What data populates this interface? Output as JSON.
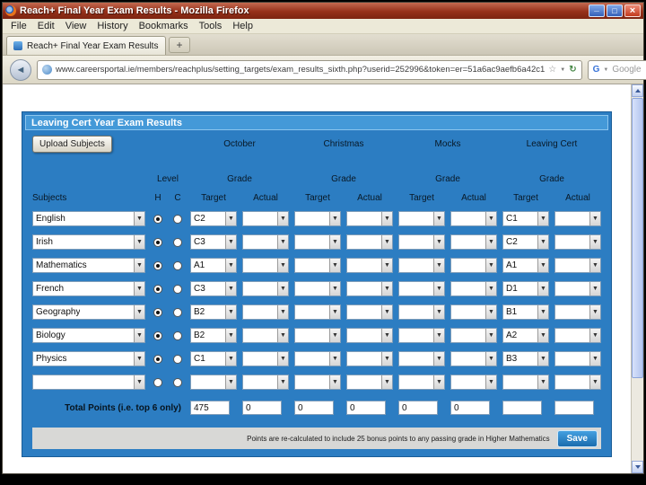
{
  "window": {
    "title": "Reach+ Final Year Exam Results - Mozilla Firefox"
  },
  "menubar": {
    "items": [
      "File",
      "Edit",
      "View",
      "History",
      "Bookmarks",
      "Tools",
      "Help"
    ]
  },
  "tabbar": {
    "active_tab": "Reach+ Final Year Exam Results",
    "new_tab": "+"
  },
  "navbar": {
    "url": "www.careersportal.ie/members/reachplus/setting_targets/exam_results_sixth.php?userid=252996&token=er=51a6ac9aefb6a42c1",
    "search_text": "Google"
  },
  "page": {
    "title": "Leaving Cert Year Exam Results",
    "upload_button": "Upload Subjects",
    "terms": [
      "October",
      "Christmas",
      "Mocks",
      "Leaving Cert"
    ],
    "level_header": "Level",
    "grade_header": "Grade",
    "columns": {
      "subjects": "Subjects",
      "h": "H",
      "c": "C",
      "target": "Target",
      "actual": "Actual"
    },
    "rows": [
      {
        "subject": "English",
        "level": "H",
        "grades": [
          "C2",
          "",
          "",
          "",
          "",
          "",
          "C1",
          ""
        ]
      },
      {
        "subject": "Irish",
        "level": "H",
        "grades": [
          "C3",
          "",
          "",
          "",
          "",
          "",
          "C2",
          ""
        ]
      },
      {
        "subject": "Mathematics",
        "level": "H",
        "grades": [
          "A1",
          "",
          "",
          "",
          "",
          "",
          "A1",
          ""
        ]
      },
      {
        "subject": "French",
        "level": "H",
        "grades": [
          "C3",
          "",
          "",
          "",
          "",
          "",
          "D1",
          ""
        ]
      },
      {
        "subject": "Geography",
        "level": "H",
        "grades": [
          "B2",
          "",
          "",
          "",
          "",
          "",
          "B1",
          ""
        ]
      },
      {
        "subject": "Biology",
        "level": "H",
        "grades": [
          "B2",
          "",
          "",
          "",
          "",
          "",
          "A2",
          ""
        ]
      },
      {
        "subject": "Physics",
        "level": "H",
        "grades": [
          "C1",
          "",
          "",
          "",
          "",
          "",
          "B3",
          ""
        ]
      },
      {
        "subject": "",
        "level": "",
        "grades": [
          "",
          "",
          "",
          "",
          "",
          "",
          "",
          ""
        ]
      }
    ],
    "totals": {
      "label": "Total Points (i.e. top 6 only)",
      "values": [
        "475",
        "0",
        "0",
        "0",
        "0",
        "0",
        "",
        ""
      ]
    },
    "footer": {
      "note": "Points are re-calculated to include 25 bonus points to any passing grade in Higher Mathematics",
      "save_button": "Save"
    }
  },
  "colors": {
    "panel_blue": "#2c7dc2",
    "panel_header_blue": "#4499d8",
    "save_button_blue": "#1b6cae",
    "titlebar_red": "#96301a"
  }
}
